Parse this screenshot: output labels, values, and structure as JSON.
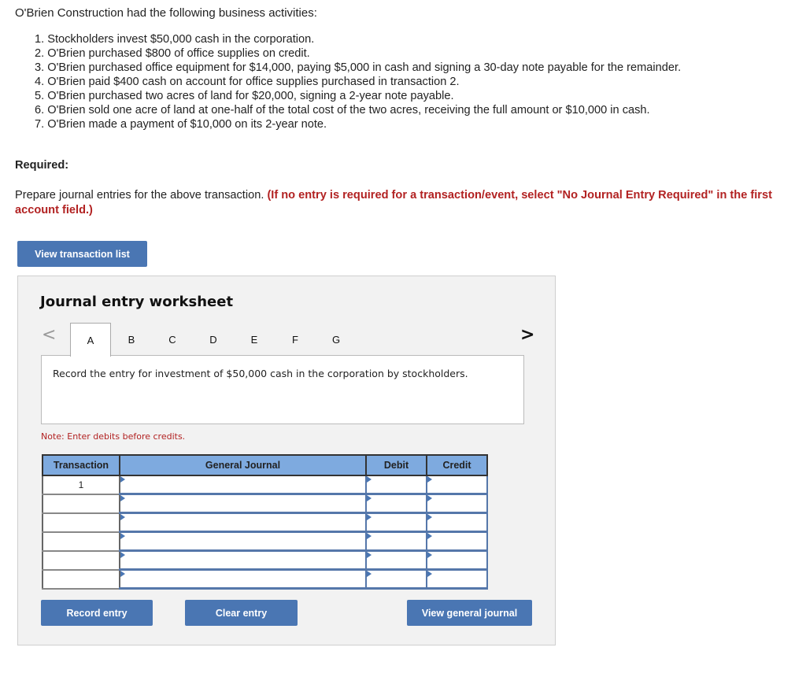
{
  "intro": "O'Brien Construction had the following business activities:",
  "activities": [
    "1. Stockholders invest $50,000 cash in the corporation.",
    "2. O'Brien purchased $800 of office supplies on credit.",
    "3. O'Brien purchased office equipment for $14,000, paying $5,000 in cash and signing a 30-day note payable for the remainder.",
    "4. O'Brien paid $400 cash on account for office supplies purchased in transaction 2.",
    "5. O'Brien purchased two acres of land for $20,000, signing a 2-year note payable.",
    "6. O'Brien sold one acre of land at one-half of the total cost of the two acres, receiving the full amount or $10,000 in cash.",
    "7. O'Brien made a payment of $10,000 on its 2-year note."
  ],
  "required": {
    "label": "Required:",
    "instruction": "Prepare journal entries for the above transaction. ",
    "instruction_highlight": "(If no entry is required for a transaction/event, select \"No Journal Entry Required\" in the first account field.)"
  },
  "buttons": {
    "view_transaction_list": "View transaction list",
    "record_entry": "Record entry",
    "clear_entry": "Clear entry",
    "view_general_journal": "View general journal"
  },
  "worksheet": {
    "title": "Journal entry worksheet",
    "prev_icon": "<",
    "next_icon": ">",
    "tabs": [
      "A",
      "B",
      "C",
      "D",
      "E",
      "F",
      "G"
    ],
    "active_tab": "A",
    "prompt": "Record the entry for investment of $50,000 cash in the corporation by stockholders.",
    "note": "Note: Enter debits before credits.",
    "table": {
      "headers": [
        "Transaction",
        "General Journal",
        "Debit",
        "Credit"
      ],
      "rows": [
        {
          "transaction": "1",
          "account": "",
          "debit": "",
          "credit": ""
        },
        {
          "transaction": "",
          "account": "",
          "debit": "",
          "credit": ""
        },
        {
          "transaction": "",
          "account": "",
          "debit": "",
          "credit": ""
        },
        {
          "transaction": "",
          "account": "",
          "debit": "",
          "credit": ""
        },
        {
          "transaction": "",
          "account": "",
          "debit": "",
          "credit": ""
        },
        {
          "transaction": "",
          "account": "",
          "debit": "",
          "credit": ""
        }
      ]
    }
  },
  "colors": {
    "button_blue": "#4a76b3",
    "header_blue": "#7eaadf",
    "alert_red": "#b22222",
    "panel_gray": "#f2f2f2"
  }
}
